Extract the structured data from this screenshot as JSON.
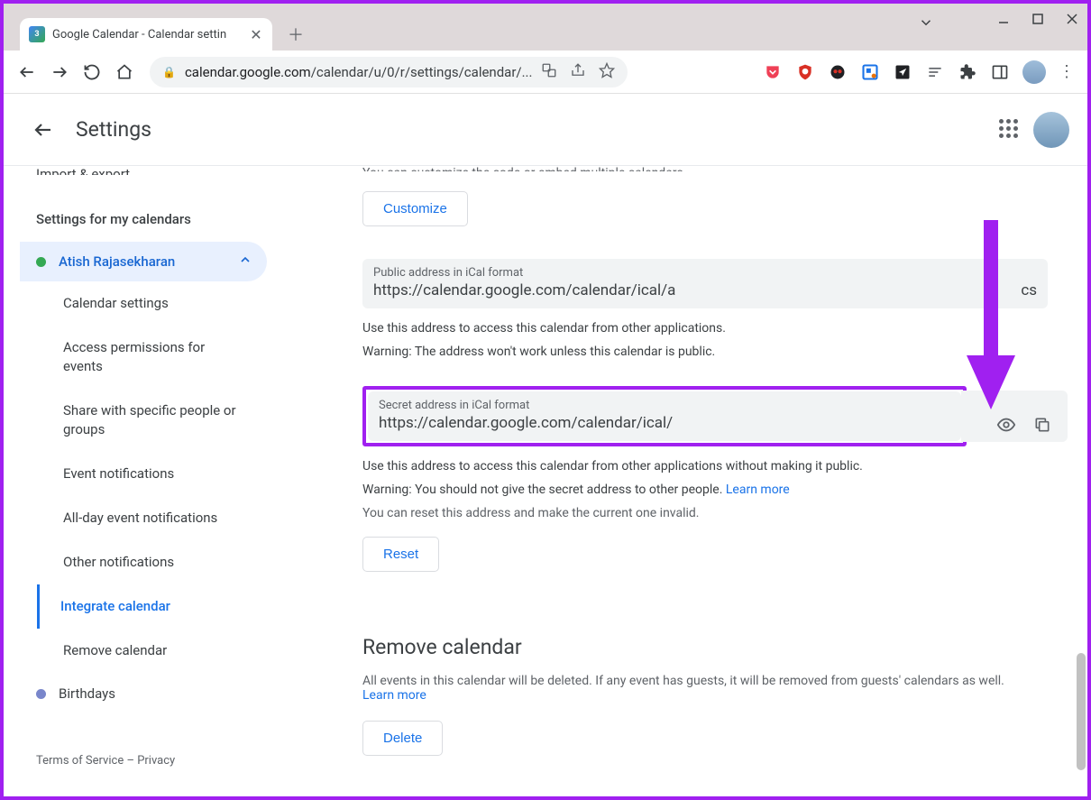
{
  "browser": {
    "tab_title": "Google Calendar - Calendar settin",
    "tab_favicon_text": "3",
    "url_host": "calendar.google.com",
    "url_path": "/calendar/u/0/r/settings/calendar/..."
  },
  "header": {
    "title": "Settings"
  },
  "sidebar": {
    "truncated_item": "Import & export",
    "section_title": "Settings for my calendars",
    "active_calendar": "Atish Rajasekharan",
    "sub_items": [
      "Calendar settings",
      "Access permissions for events",
      "Share with specific people or groups",
      "Event notifications",
      "All-day event notifications",
      "Other notifications",
      "Integrate calendar",
      "Remove calendar"
    ],
    "active_sub_index": 6,
    "other_calendar": "Birthdays",
    "footer": {
      "tos": "Terms of Service",
      "sep": " – ",
      "privacy": "Privacy"
    }
  },
  "content": {
    "truncated_top_text": "You can customize the code or embed multiple calendars.",
    "customize_button": "Customize",
    "public_address": {
      "label": "Public address in iCal format",
      "value": "https://calendar.google.com/calendar/ical/a",
      "trailing": "cs",
      "help": "Use this address to access this calendar from other applications.",
      "warning": "Warning: The address won't work unless this calendar is public."
    },
    "secret_address": {
      "label": "Secret address in iCal format",
      "value": "https://calendar.google.com/calendar/ical/",
      "help": "Use this address to access this calendar from other applications without making it public.",
      "warning_prefix": "Warning: You should not give the secret address to other people. ",
      "learn_more": "Learn more",
      "reset_help": "You can reset this address and make the current one invalid.",
      "reset_button": "Reset"
    },
    "remove": {
      "title": "Remove calendar",
      "body_prefix": "All events in this calendar will be deleted. If any event has guests, it will be removed from guests' calendars as well. ",
      "learn_more": "Learn more",
      "delete_button": "Delete"
    }
  }
}
